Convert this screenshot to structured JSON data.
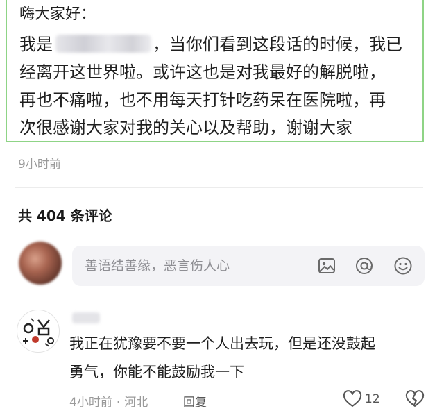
{
  "post": {
    "greeting": "嗨大家好：",
    "line1_prefix": "我是",
    "line1_suffix": "，当你们看到这段话的时候，我已",
    "line2": "经离开这世界啦。或许这也是对我最好的解脱啦，",
    "line3": "再也不痛啦，也不用每天打针吃药呆在医院啦，再",
    "line4": "次很感谢大家对我的关心以及帮助，谢谢大家",
    "time": "9小时前",
    "border_color": "#8fd486"
  },
  "comments_header": {
    "count_text": "共 404 条评论"
  },
  "comment_input": {
    "placeholder": "善语结善缘，恶言伤人心",
    "icons": [
      "image-icon",
      "at-icon",
      "emoji-icon"
    ]
  },
  "comment": {
    "line1": "我正在犹豫要不要一个人出去玩，但是还没鼓起",
    "line2": "勇气，你能不能鼓励我一下",
    "time": "4小时前",
    "separator": "·",
    "location": "河北",
    "reply_label": "回复",
    "like_count": "12"
  }
}
